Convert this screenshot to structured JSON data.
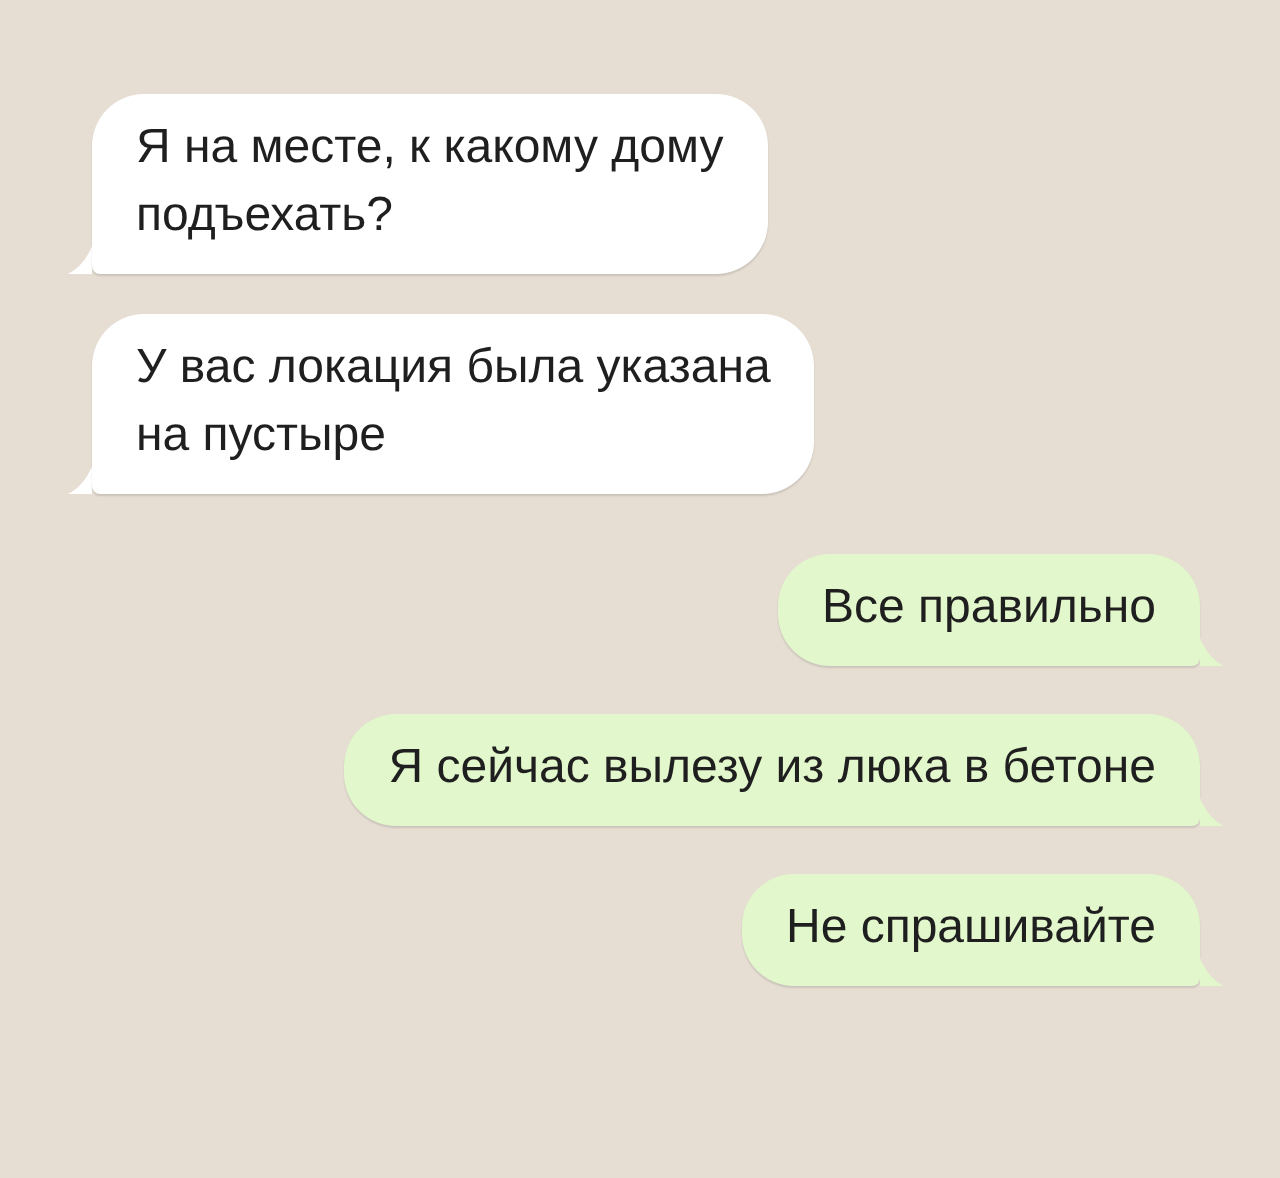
{
  "messages": [
    {
      "kind": "incoming",
      "lines": [
        "Я на месте, к какому дому",
        "подъехать?"
      ]
    },
    {
      "kind": "incoming",
      "lines": [
        "У вас локация была указана",
        "на пустыре"
      ]
    },
    {
      "kind": "outgoing",
      "lines": [
        "Все правильно"
      ]
    },
    {
      "kind": "outgoing",
      "lines": [
        "Я сейчас вылезу из люка в бетоне"
      ]
    },
    {
      "kind": "outgoing",
      "lines": [
        "Не спрашивайте"
      ]
    }
  ]
}
